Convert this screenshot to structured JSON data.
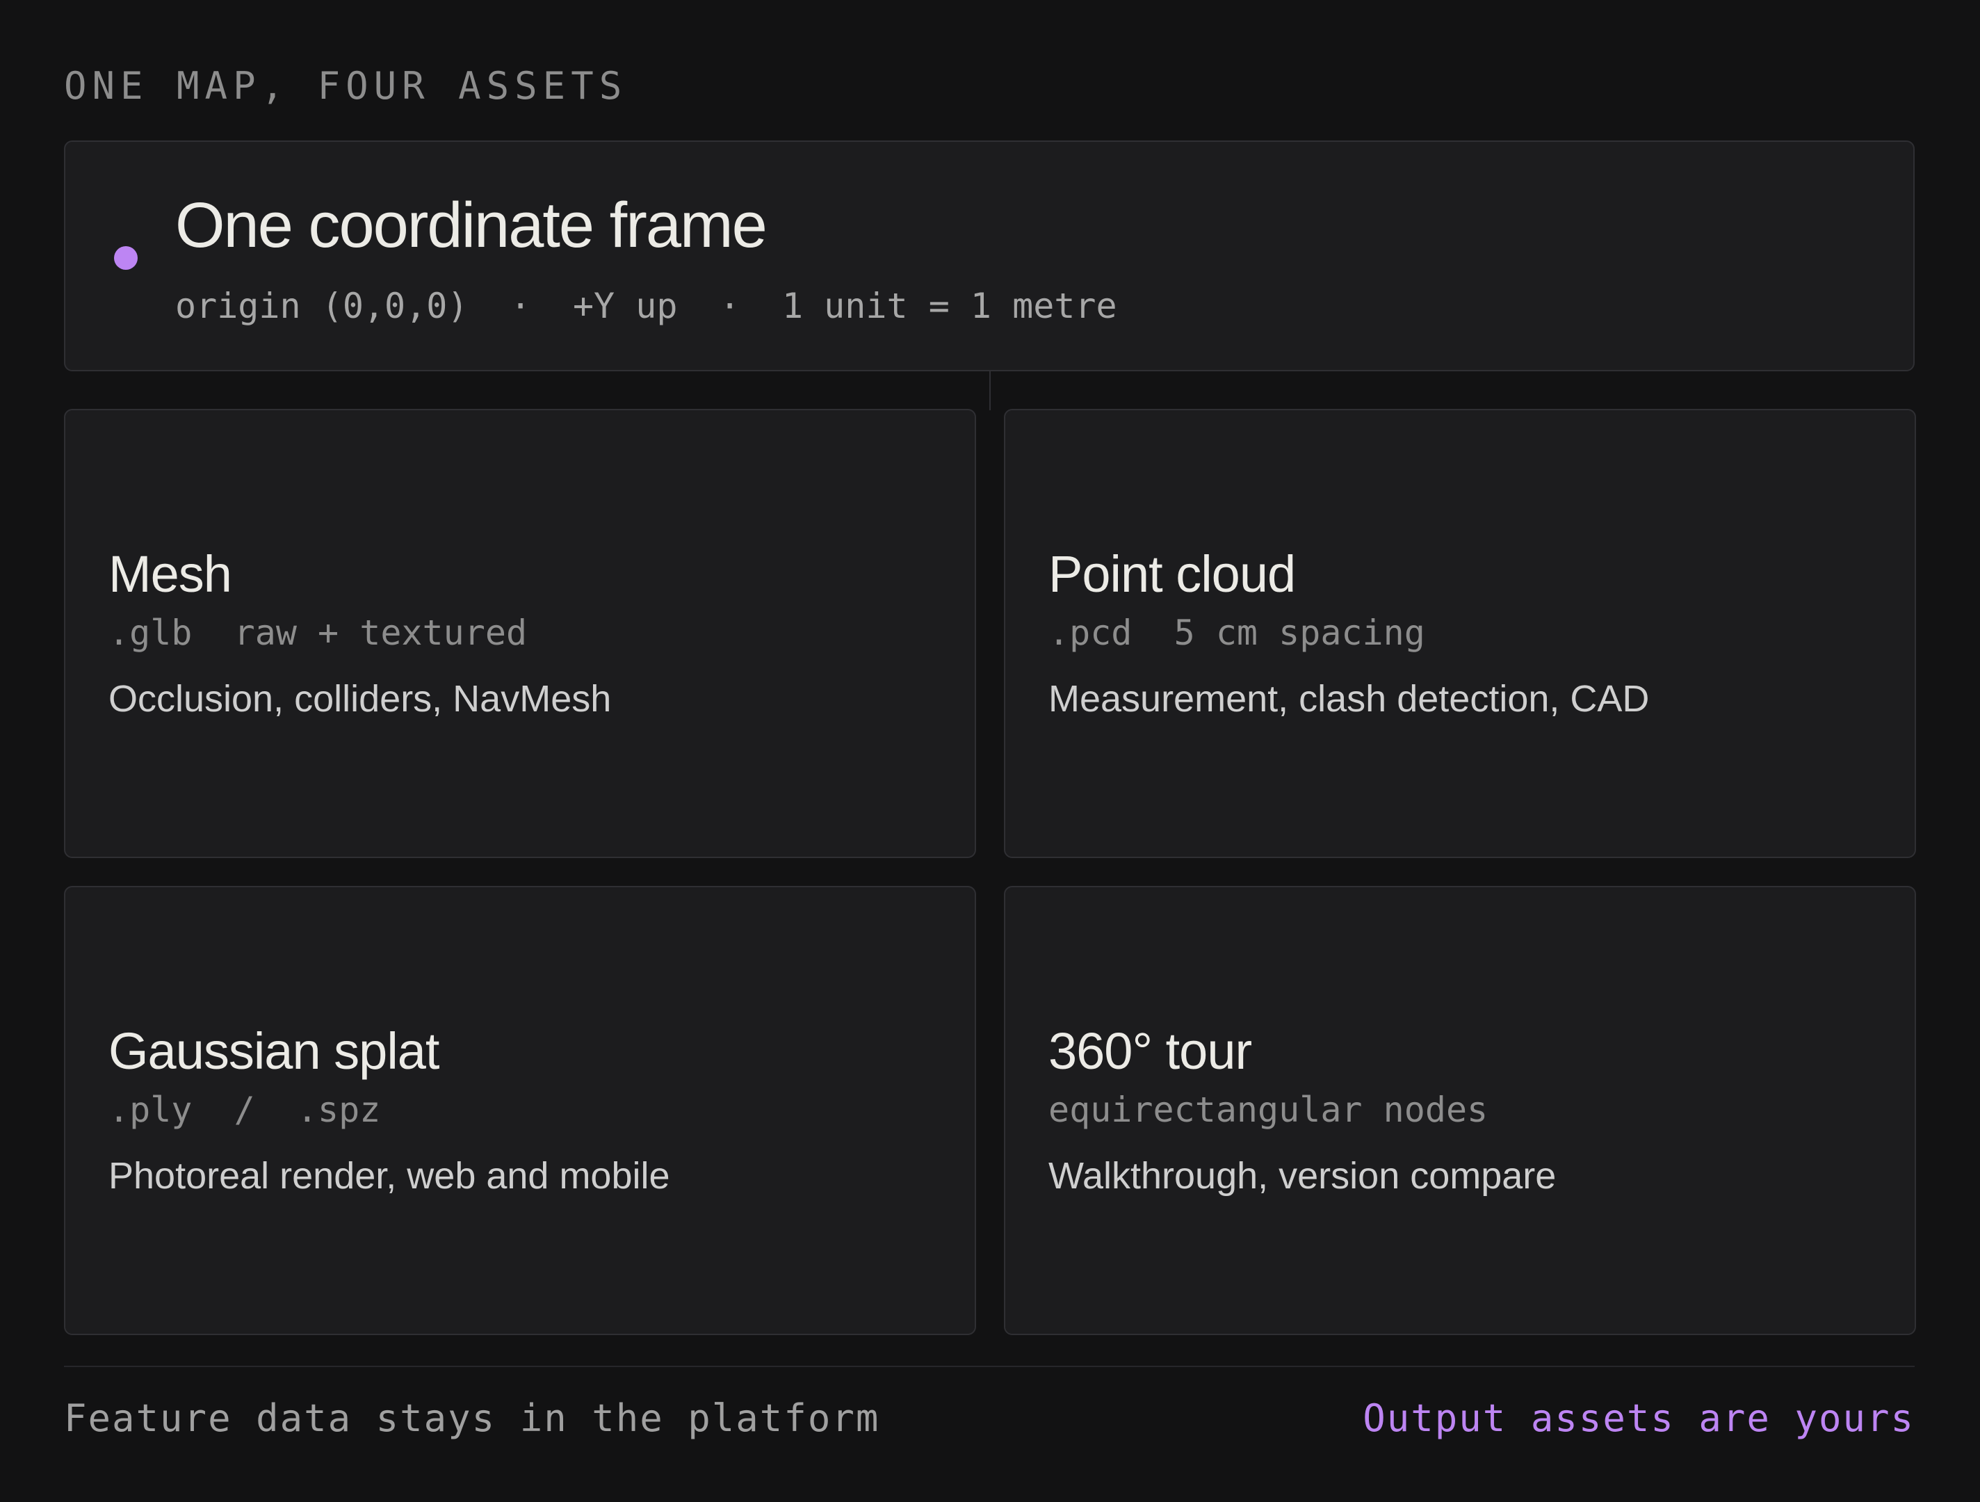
{
  "eyebrow": "ONE MAP, FOUR ASSETS",
  "frame": {
    "title": "One coordinate frame",
    "meta": "origin (0,0,0)  ·  +Y up  ·  1 unit = 1 metre",
    "dot_color": "#bd85f3"
  },
  "assets": [
    {
      "title": "Mesh",
      "format": ".glb  raw + textured",
      "use": "Occlusion, colliders, NavMesh"
    },
    {
      "title": "Point cloud",
      "format": ".pcd  5 cm spacing",
      "use": "Measurement, clash detection, CAD"
    },
    {
      "title": "Gaussian splat",
      "format": ".ply  /  .spz",
      "use": "Photoreal render, web and mobile"
    },
    {
      "title": "360° tour",
      "format": "equirectangular nodes",
      "use": "Walkthrough, version compare"
    }
  ],
  "footer": {
    "left": "Feature data stays in the platform",
    "right": "Output assets are yours",
    "accent_color": "#bd85f3"
  }
}
